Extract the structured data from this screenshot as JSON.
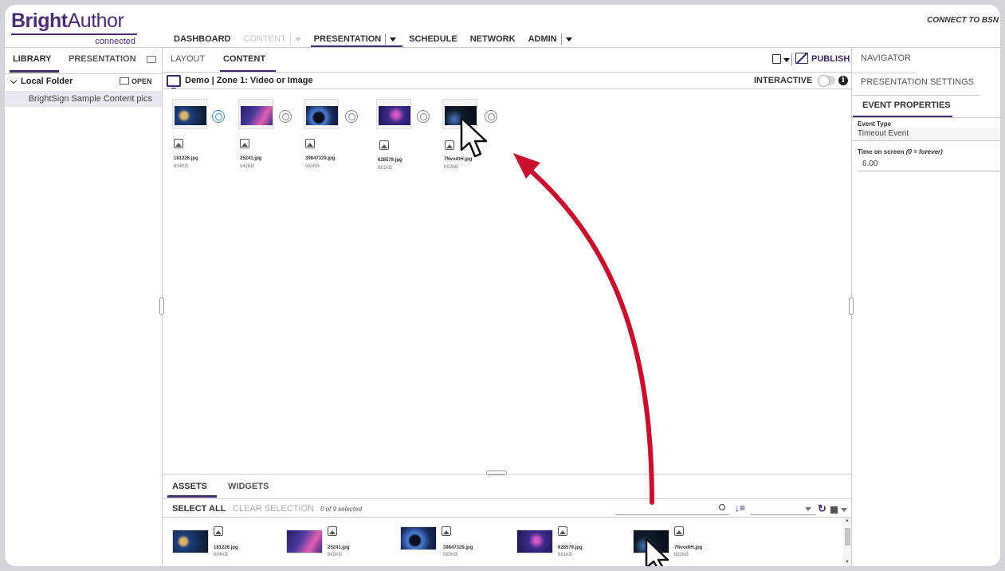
{
  "app": {
    "brand_bold": "Bright",
    "brand_regular": "Author",
    "brand_sub": "connected",
    "connect_label": "CONNECT TO BSN"
  },
  "topnav": {
    "dashboard": "DASHBOARD",
    "content": "CONTENT",
    "presentation": "PRESENTATION",
    "schedule": "SCHEDULE",
    "network": "NETWORK",
    "admin": "ADMIN"
  },
  "left_panel": {
    "tab_library": "LIBRARY",
    "tab_presentation": "PRESENTATION",
    "folder_label": "Local Folder",
    "open_label": "OPEN",
    "selected_item": "BrightSign Sample Content pics"
  },
  "center": {
    "tab_layout": "LAYOUT",
    "tab_content": "CONTENT",
    "publish_label": "PUBLISH",
    "zone_title": "Demo | Zone 1: Video or Image",
    "interactive_label": "INTERACTIVE",
    "canvas_items": [
      {
        "name": "181226.jpg",
        "size": "604KB",
        "color": "#1d3f7a",
        "accent": "#d9b46a",
        "timer_active": true
      },
      {
        "name": "25241.jpg",
        "size": "842KB",
        "color": "#4a3a9c",
        "accent": "#e05fb5",
        "timer_active": false
      },
      {
        "name": "39847329.jpg",
        "size": "580KB",
        "color": "#1a2c5e",
        "accent": "#4a7dd6",
        "timer_active": false
      },
      {
        "name": "628579.jpg",
        "size": "681KB",
        "color": "#3c2a8a",
        "accent": "#d657c8",
        "timer_active": false
      },
      {
        "name": "7NvodtH.jpg",
        "size": "652KB",
        "color": "#0e1a2a",
        "accent": "#3d6aa8",
        "timer_active": false
      }
    ]
  },
  "assets": {
    "tab_assets": "ASSETS",
    "tab_widgets": "WIDGETS",
    "select_all": "SELECT ALL",
    "clear_selection": "CLEAR SELECTION",
    "selection_count": "0 of 9 selected",
    "items": [
      {
        "name": "181226.jpg",
        "size": "604KB"
      },
      {
        "name": "25241.jpg",
        "size": "842KB"
      },
      {
        "name": "39847329.jpg",
        "size": "580KB"
      },
      {
        "name": "628579.jpg",
        "size": "681KB"
      },
      {
        "name": "7NvodtH.jpg",
        "size": "652KB"
      }
    ]
  },
  "right_panel": {
    "navigator": "NAVIGATOR",
    "presentation_settings": "PRESENTATION SETTINGS",
    "event_properties": "EVENT PROPERTIES",
    "event_type_label": "Event Type",
    "event_type_value": "Timeout Event",
    "time_on_screen_label": "Time on screen",
    "time_on_screen_hint": "(0 = forever)",
    "time_on_screen_value": "6.00"
  },
  "colors": {
    "brand": "#4a2c76",
    "accent_underline": "#3d2a6b",
    "arrow": "#c8102e",
    "timer_active": "#3b8ad8"
  }
}
